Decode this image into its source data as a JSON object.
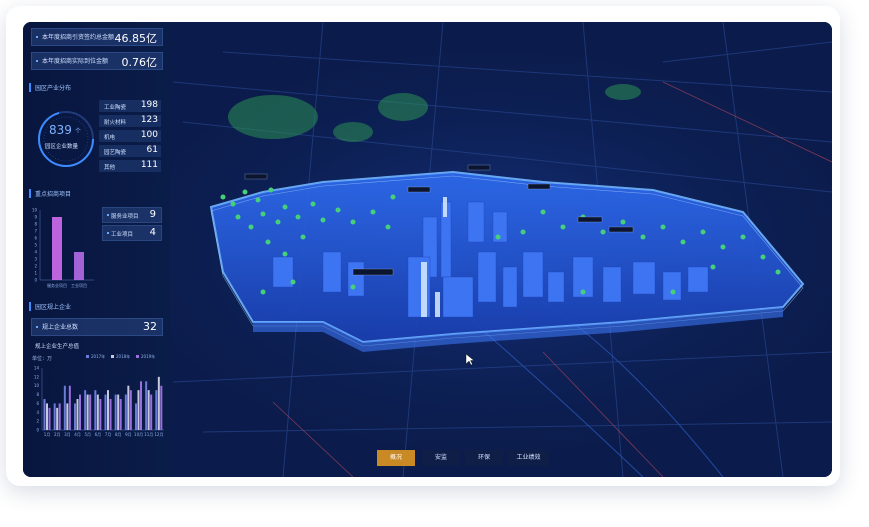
{
  "summary": {
    "row1_label": "本年度招商引资签约总金额",
    "row1_value": "46.85亿",
    "row2_label": "本年度招商实际到位金额",
    "row2_value": "0.76亿"
  },
  "industry": {
    "title": "园区产业分布",
    "total_value": "839",
    "total_arrow": "个",
    "total_label": "园区企业数量",
    "items": [
      {
        "label": "工业陶瓷",
        "value": "198"
      },
      {
        "label": "耐火材料",
        "value": "123"
      },
      {
        "label": "机电",
        "value": "100"
      },
      {
        "label": "园艺陶瓷",
        "value": "61"
      },
      {
        "label": "其他",
        "value": "111"
      }
    ]
  },
  "projects": {
    "title": "重点招商项目",
    "service_label": "服务业项目",
    "service_value": "9",
    "industry_label": "工业项目",
    "industry_value": "4",
    "chart_data": {
      "type": "bar",
      "categories": [
        "服务业项目",
        "工业项目"
      ],
      "values": [
        9,
        4
      ],
      "yticks": [
        "10",
        "9",
        "8",
        "7",
        "6",
        "5",
        "4",
        "3",
        "2",
        "1",
        "0"
      ],
      "ylim": [
        0,
        10
      ]
    }
  },
  "enterprises": {
    "title": "园区规上企业",
    "count_label": "规上企业总数",
    "count_value": "32",
    "output_label": "规上企业生产总值",
    "unit": "单位：万",
    "chart_data": {
      "type": "bar",
      "categories": [
        "1月",
        "2月",
        "3月",
        "4月",
        "5月",
        "6月",
        "7月",
        "8月",
        "9月",
        "10月",
        "11月",
        "12月"
      ],
      "series": [
        {
          "name": "2017年",
          "color": "#6a7bd8",
          "values": [
            7,
            6,
            10,
            6,
            9,
            9,
            8,
            8,
            8,
            6,
            11,
            9
          ]
        },
        {
          "name": "2018年",
          "color": "#c7c9dd",
          "values": [
            6,
            5,
            6,
            7,
            8,
            8,
            9,
            8,
            10,
            9,
            9,
            12
          ]
        },
        {
          "name": "2019年",
          "color": "#9c6fe0",
          "values": [
            5,
            6,
            10,
            8,
            8,
            7,
            7,
            7,
            9,
            11,
            8,
            10
          ]
        }
      ],
      "yticks": [
        "14",
        "12",
        "10",
        "8",
        "6",
        "4",
        "2",
        "0"
      ],
      "ylim": [
        0,
        14
      ]
    }
  },
  "tabs": [
    "概况",
    "安监",
    "环保",
    "工业绩效"
  ],
  "active_tab": "概况",
  "colors": {
    "accent": "#3d8bff",
    "active_tab": "#c98a25",
    "district": "#2a64e8",
    "trees": "#3fbf6a"
  }
}
